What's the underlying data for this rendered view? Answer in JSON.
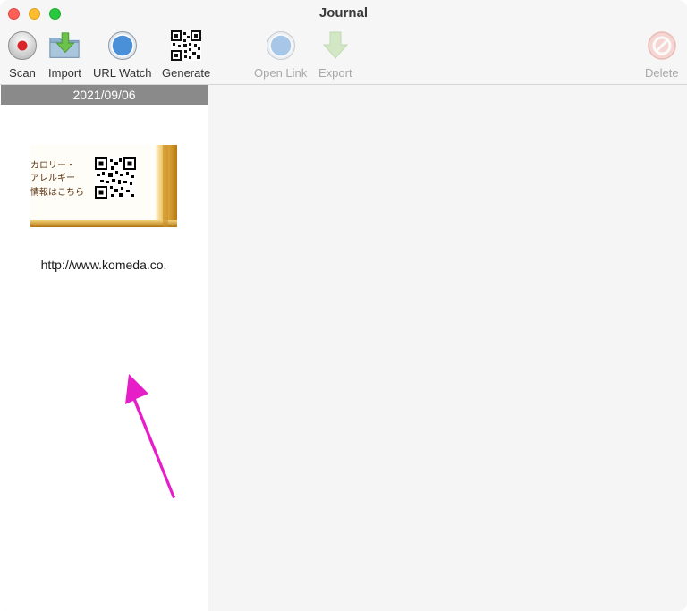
{
  "window": {
    "title": "Journal"
  },
  "toolbar": {
    "scan": "Scan",
    "import": "Import",
    "url_watch": "URL Watch",
    "generate": "Generate",
    "open_link": "Open Link",
    "export": "Export",
    "delete": "Delete"
  },
  "sidebar": {
    "date": "2021/09/06",
    "entry": {
      "thumb_lines": [
        "カロリー・",
        "アレルギー",
        "情報はこちら"
      ],
      "url": "http://www.komeda.co."
    }
  },
  "colors": {
    "annotation_arrow": "#e61ec8",
    "date_header_bg": "#8a8a8a"
  }
}
